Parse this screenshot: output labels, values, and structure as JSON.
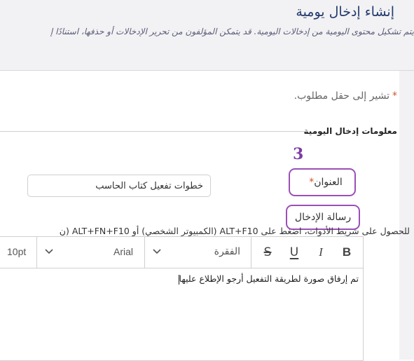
{
  "header": {
    "title": "إنشاء إدخال يومية",
    "description": "يتم تشكيل محتوى اليومية من إدخالات اليومية. قد يتمكن المؤلفون من تحرير الإدخالات أو حذفها، استنادًا إ"
  },
  "form": {
    "required_note": "تشير إلى حقل مطلوب.",
    "required_marker": "*",
    "section_title": "معلومات إدخال اليومية",
    "step_number": "3",
    "title_label": "العنوان",
    "title_value": "خطوات تفعيل كتاب الحاسب",
    "message_label": "رسالة الإدخال",
    "toolbar_hint": "للحصول على شريط الأدوات، اضغط على ALT+F10 (الكمبيوتر الشخصي) أو ALT+FN+F10 (ن"
  },
  "editor": {
    "toolbar": {
      "bold": "B",
      "italic": "I",
      "underline": "U",
      "strikethrough": "S",
      "paragraph_format": "الفقرة",
      "font_family": "Arial",
      "font_size": "10pt"
    },
    "content": "تم إرفاق صورة لطريقة التفعيل أرجو الإطلاع عليها"
  },
  "colors": {
    "title": "#243a6e",
    "required": "#d0542b",
    "highlight": "#9b4fb8"
  }
}
